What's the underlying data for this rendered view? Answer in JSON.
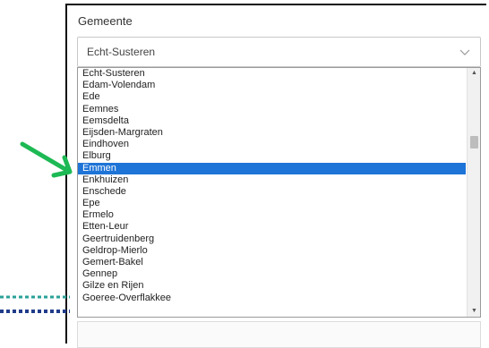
{
  "field": {
    "label": "Gemeente",
    "selected_value": "Echt-Susteren"
  },
  "dropdown": {
    "options": [
      "Echt-Susteren",
      "Edam-Volendam",
      "Ede",
      "Eemnes",
      "Eemsdelta",
      "Eijsden-Margraten",
      "Eindhoven",
      "Elburg",
      "Emmen",
      "Enkhuizen",
      "Enschede",
      "Epe",
      "Ermelo",
      "Etten-Leur",
      "Geertruidenberg",
      "Geldrop-Mierlo",
      "Gemert-Bakel",
      "Gennep",
      "Gilze en Rijen",
      "Goeree-Overflakkee"
    ],
    "highlighted_index": 8
  },
  "colors": {
    "highlight": "#1e74d7",
    "annotation_arrow": "#1db954",
    "dotted_line_teal": "#2aa198",
    "dotted_line_blue": "#1f3b8a"
  },
  "icons": {
    "chevron": "chevron-down-icon",
    "arrow": "arrow-pointer-icon"
  }
}
